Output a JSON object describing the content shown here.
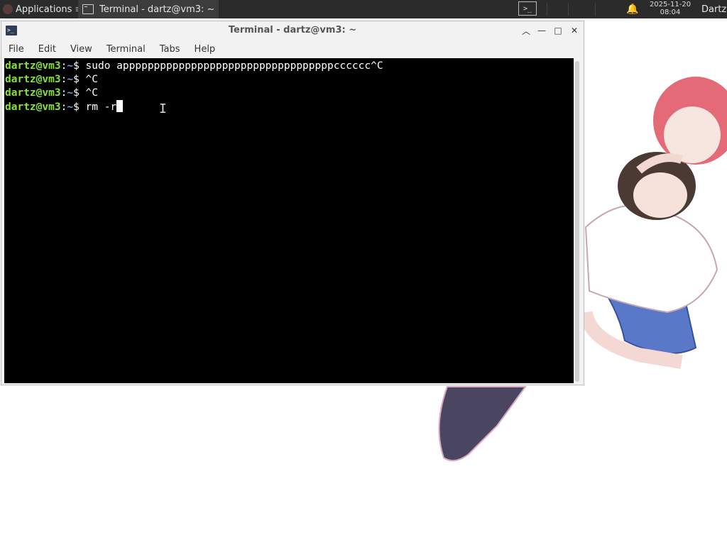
{
  "panel": {
    "applications_label": "Applications",
    "task_title": "Terminal - dartz@vm3: ~",
    "clock_date": "2025-11-20",
    "clock_time": "08:04",
    "user_label": "Dartz",
    "bell_icon": "bell-icon",
    "terminal_launcher_label": ">_"
  },
  "window": {
    "title": "Terminal - dartz@vm3: ~",
    "menu": [
      "File",
      "Edit",
      "View",
      "Terminal",
      "Tabs",
      "Help"
    ]
  },
  "terminal": {
    "prompt_user": "dartz@vm3",
    "prompt_sep": ":",
    "prompt_path": "~",
    "prompt_suffix": "$ ",
    "lines": [
      "sudo appppppppppppppppppppppppppppppppppcccccc^C",
      "^C",
      "^C",
      "rm -r"
    ]
  },
  "colors": {
    "panel_bg": "#2b2b2b",
    "terminal_bg": "#000000",
    "prompt_user": "#8ae234",
    "prompt_path": "#729fcf"
  }
}
